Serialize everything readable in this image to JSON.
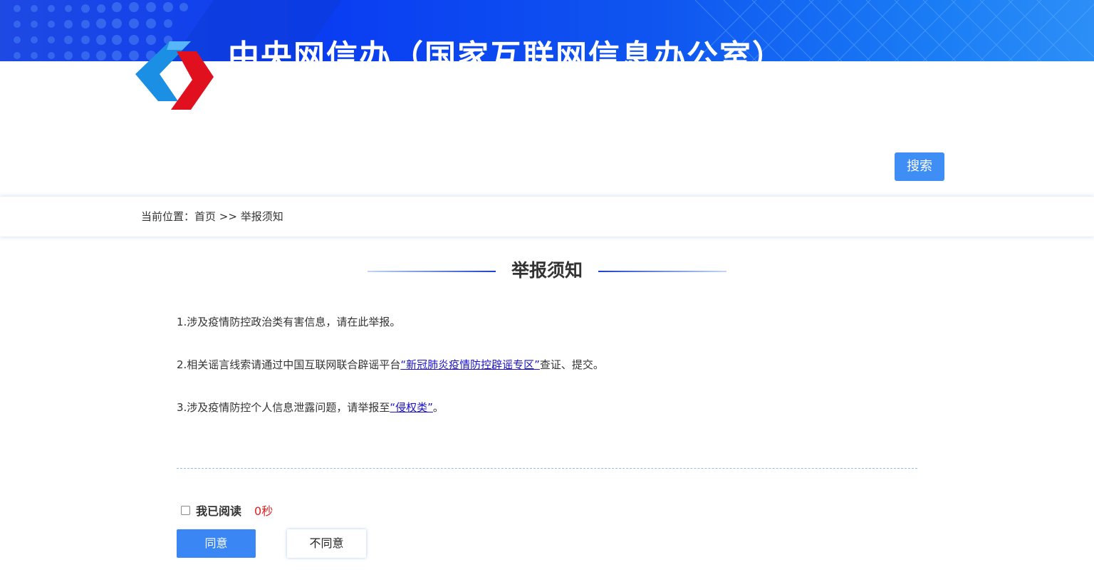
{
  "site": {
    "title": "中央网信办（国家互联网信息办公室）"
  },
  "search": {
    "button_label": "搜索"
  },
  "breadcrumb": {
    "prefix": "当前位置：",
    "home": "首页",
    "separator": " >> ",
    "current": "举报须知"
  },
  "notice": {
    "heading": "举报须知",
    "item1": "1.涉及疫情防控政治类有害信息，请在此举报。",
    "item2_before": "2.相关谣言线索请通过中国互联网联合辟谣平台",
    "item2_link": "“新冠肺炎疫情防控辟谣专区”",
    "item2_after": "查证、提交。",
    "item3_before": "3.涉及疫情防控个人信息泄露问题，请举报至",
    "item3_link": "“侵权类”",
    "item3_after": "。"
  },
  "confirm": {
    "read_label": "我已阅读",
    "countdown": "0秒",
    "agree_label": "同意",
    "disagree_label": "不同意"
  },
  "colors": {
    "accent": "#3a86f4",
    "link": "#1a10c8",
    "countdown": "#e02020",
    "banner": "#0a3df2"
  }
}
